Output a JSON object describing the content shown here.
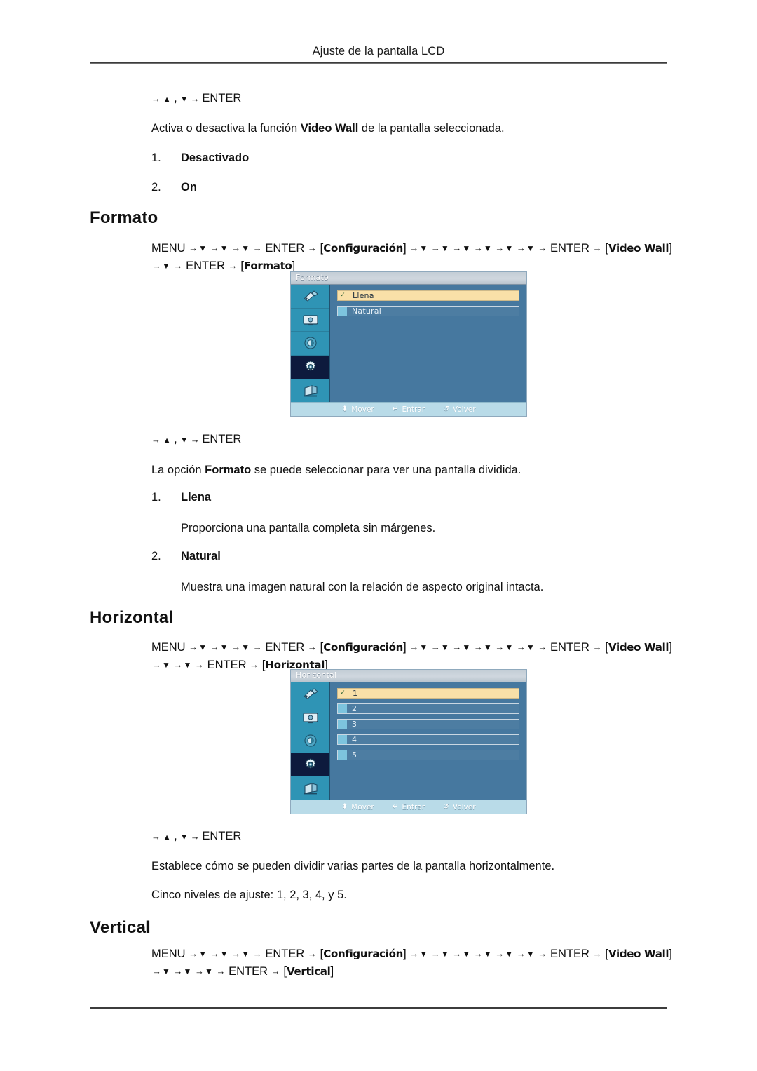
{
  "page": {
    "running_header": "Ajuste de la pantalla LCD"
  },
  "videowall_tail": {
    "nav": {
      "prefix": "→",
      "up": "▲",
      "sep": ",",
      "down": "▼",
      "arrow": "→",
      "enter": "ENTER"
    },
    "description_pre": "Activa o desactiva la función ",
    "description_bold": "Video Wall",
    "description_post": " de la pantalla seleccionada.",
    "options": [
      {
        "num": "1.",
        "label": "Desactivado"
      },
      {
        "num": "2.",
        "label": "On"
      }
    ]
  },
  "sections": [
    {
      "id": "formato",
      "title": "Formato",
      "path": {
        "menu": "MENU",
        "downs_1": 3,
        "enter_1": "ENTER",
        "token_1": "Configuración",
        "downs_2": 6,
        "enter_2": "ENTER",
        "token_2": "Video Wall",
        "downs_3": 1,
        "enter_3": "ENTER",
        "token_3": "Formato"
      },
      "osd": {
        "title": "Formato",
        "rows": [
          {
            "label": "Llena",
            "selected": true
          },
          {
            "label": "Natural",
            "selected": false
          }
        ],
        "footer": [
          {
            "icon": "updown-arrow-icon",
            "glyph": "⬍",
            "label": "Mover"
          },
          {
            "icon": "enter-key-icon",
            "glyph": "↵",
            "label": "Entrar"
          },
          {
            "icon": "return-arrow-icon",
            "glyph": "↺",
            "label": "Volver"
          }
        ],
        "sidebar_icons": [
          "picture-brush-icon",
          "screen-image-icon",
          "sound-icon",
          "setup-gear-icon",
          "multi-control-icon"
        ],
        "active_sidebar_index": 3
      },
      "nav": {
        "prefix": "→",
        "up": "▲",
        "sep": ",",
        "down": "▼",
        "arrow": "→",
        "enter": "ENTER"
      },
      "description_pre": "La opción ",
      "description_bold": "Formato",
      "description_post": " se puede seleccionar para ver una pantalla dividida.",
      "options": [
        {
          "num": "1.",
          "label": "Llena",
          "detail": "Proporciona una pantalla completa sin márgenes."
        },
        {
          "num": "2.",
          "label": "Natural",
          "detail": "Muestra una imagen natural con la relación de aspecto original intacta."
        }
      ]
    },
    {
      "id": "horizontal",
      "title": "Horizontal",
      "path": {
        "menu": "MENU",
        "downs_1": 3,
        "enter_1": "ENTER",
        "token_1": "Configuración",
        "downs_2": 6,
        "enter_2": "ENTER",
        "token_2": "Video Wall",
        "downs_3": 2,
        "enter_3": "ENTER",
        "token_3": "Horizontal"
      },
      "osd": {
        "title": "Horizontal",
        "rows": [
          {
            "label": "1",
            "selected": true
          },
          {
            "label": "2",
            "selected": false
          },
          {
            "label": "3",
            "selected": false
          },
          {
            "label": "4",
            "selected": false
          },
          {
            "label": "5",
            "selected": false
          }
        ],
        "footer": [
          {
            "icon": "updown-arrow-icon",
            "glyph": "⬍",
            "label": "Mover"
          },
          {
            "icon": "enter-key-icon",
            "glyph": "↵",
            "label": "Entrar"
          },
          {
            "icon": "return-arrow-icon",
            "glyph": "↺",
            "label": "Volver"
          }
        ],
        "sidebar_icons": [
          "picture-brush-icon",
          "screen-image-icon",
          "sound-icon",
          "setup-gear-icon",
          "multi-control-icon"
        ],
        "active_sidebar_index": 3
      },
      "nav": {
        "prefix": "→",
        "up": "▲",
        "sep": ",",
        "down": "▼",
        "arrow": "→",
        "enter": "ENTER"
      },
      "paragraphs": [
        "Establece cómo se pueden dividir varias partes de la pantalla horizontalmente.",
        "Cinco niveles de ajuste: 1, 2, 3, 4, y 5."
      ]
    },
    {
      "id": "vertical",
      "title": "Vertical",
      "path": {
        "menu": "MENU",
        "downs_1": 3,
        "enter_1": "ENTER",
        "token_1": "Configuración",
        "downs_2": 6,
        "enter_2": "ENTER",
        "token_2": "Video Wall",
        "downs_3": 3,
        "enter_3": "ENTER",
        "token_3": "Vertical"
      }
    }
  ],
  "colors": {
    "osd_body": "#46789f",
    "osd_sidebar": "#2f94b5",
    "osd_sidebar_active": "#0d1a3d",
    "osd_selected_row": "#f9e0a8",
    "osd_footer": "#b9dbe8",
    "osd_titlebar": "#cfd7de"
  }
}
